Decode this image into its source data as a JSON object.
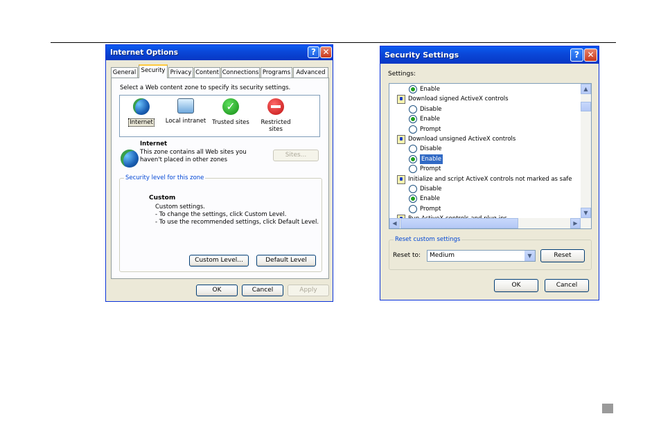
{
  "internet_options": {
    "title": "Internet Options",
    "help_glyph": "?",
    "close_glyph": "✕",
    "tabs": [
      "General",
      "Security",
      "Privacy",
      "Content",
      "Connections",
      "Programs",
      "Advanced"
    ],
    "active_tab": "Security",
    "zone_prompt": "Select a Web content zone to specify its security settings.",
    "zones": [
      {
        "label": "Internet",
        "icon": "globe-icon"
      },
      {
        "label": "Local intranet",
        "icon": "network-computer-icon"
      },
      {
        "label": "Trusted sites",
        "icon": "green-check-icon"
      },
      {
        "label": "Restricted sites",
        "icon": "red-no-entry-icon"
      }
    ],
    "zone_info_title": "Internet",
    "zone_info_text_1": "This zone contains all Web sites you",
    "zone_info_text_2": "haven't placed in other zones",
    "sites_button": "Sites...",
    "security_level_legend": "Security level for this zone",
    "level_title": "Custom",
    "level_line_1": "Custom settings.",
    "level_line_2": "- To change the settings, click Custom Level.",
    "level_line_3": "- To use the recommended settings, click Default Level.",
    "custom_level_button": "Custom Level...",
    "default_level_button": "Default Level",
    "ok_button": "OK",
    "cancel_button": "Cancel",
    "apply_button": "Apply"
  },
  "security_settings": {
    "title": "Security Settings",
    "help_glyph": "?",
    "close_glyph": "✕",
    "settings_label": "Settings:",
    "list": [
      {
        "type": "option",
        "label": "Enable",
        "selected": true
      },
      {
        "type": "category",
        "label": "Download signed ActiveX controls"
      },
      {
        "type": "option",
        "label": "Disable",
        "selected": false
      },
      {
        "type": "option",
        "label": "Enable",
        "selected": true
      },
      {
        "type": "option",
        "label": "Prompt",
        "selected": false
      },
      {
        "type": "category",
        "label": "Download unsigned ActiveX controls"
      },
      {
        "type": "option",
        "label": "Disable",
        "selected": false
      },
      {
        "type": "option",
        "label": "Enable",
        "selected": true,
        "highlighted": true
      },
      {
        "type": "option",
        "label": "Prompt",
        "selected": false
      },
      {
        "type": "category",
        "label": "Initialize and script ActiveX controls not marked as safe"
      },
      {
        "type": "option",
        "label": "Disable",
        "selected": false
      },
      {
        "type": "option",
        "label": "Enable",
        "selected": true
      },
      {
        "type": "option",
        "label": "Prompt",
        "selected": false
      },
      {
        "type": "category",
        "label": "Run ActiveX controls and plug-ins"
      }
    ],
    "scroll_up_glyph": "▲",
    "scroll_down_glyph": "▼",
    "scroll_left_glyph": "◀",
    "scroll_right_glyph": "▶",
    "reset_legend": "Reset custom settings",
    "reset_to_label": "Reset to:",
    "reset_to_value": "Medium",
    "dropdown_glyph": "▼",
    "reset_button": "Reset",
    "ok_button": "OK",
    "cancel_button": "Cancel"
  }
}
